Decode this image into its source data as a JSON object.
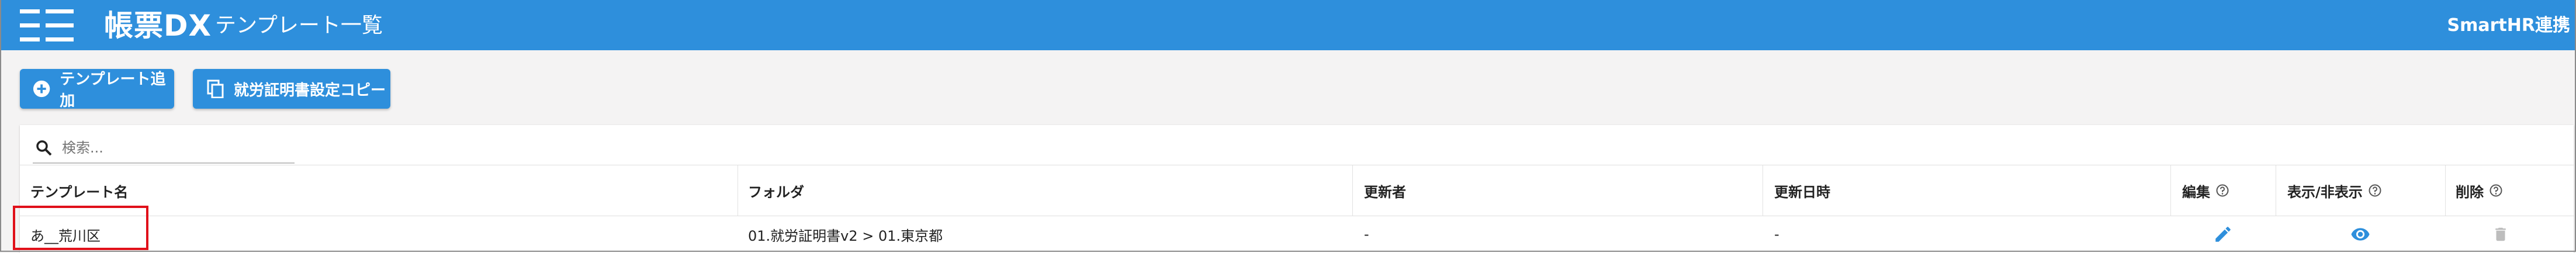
{
  "header": {
    "logo_text": "帳票DX",
    "title": "テンプレート一覧",
    "integration_link": "SmartHR連携"
  },
  "toolbar": {
    "add_label": "テンプレート追加",
    "copy_label": "就労証明書設定コピー"
  },
  "search": {
    "placeholder": "検索..."
  },
  "table": {
    "columns": {
      "name": "テンプレート名",
      "folder": "フォルダ",
      "updater": "更新者",
      "updated_at": "更新日時",
      "edit": "編集",
      "visibility": "表示/非表示",
      "delete": "削除"
    },
    "rows": [
      {
        "name": "あ__荒川区",
        "folder": "01.就労証明書v2 > 01.東京都",
        "updater": "-",
        "updated_at": "-"
      }
    ]
  },
  "colors": {
    "brand": "#2e8fdc",
    "highlight": "#e0101a",
    "icon_blue": "#2e8fdc",
    "icon_gray": "#bdbdbd"
  }
}
